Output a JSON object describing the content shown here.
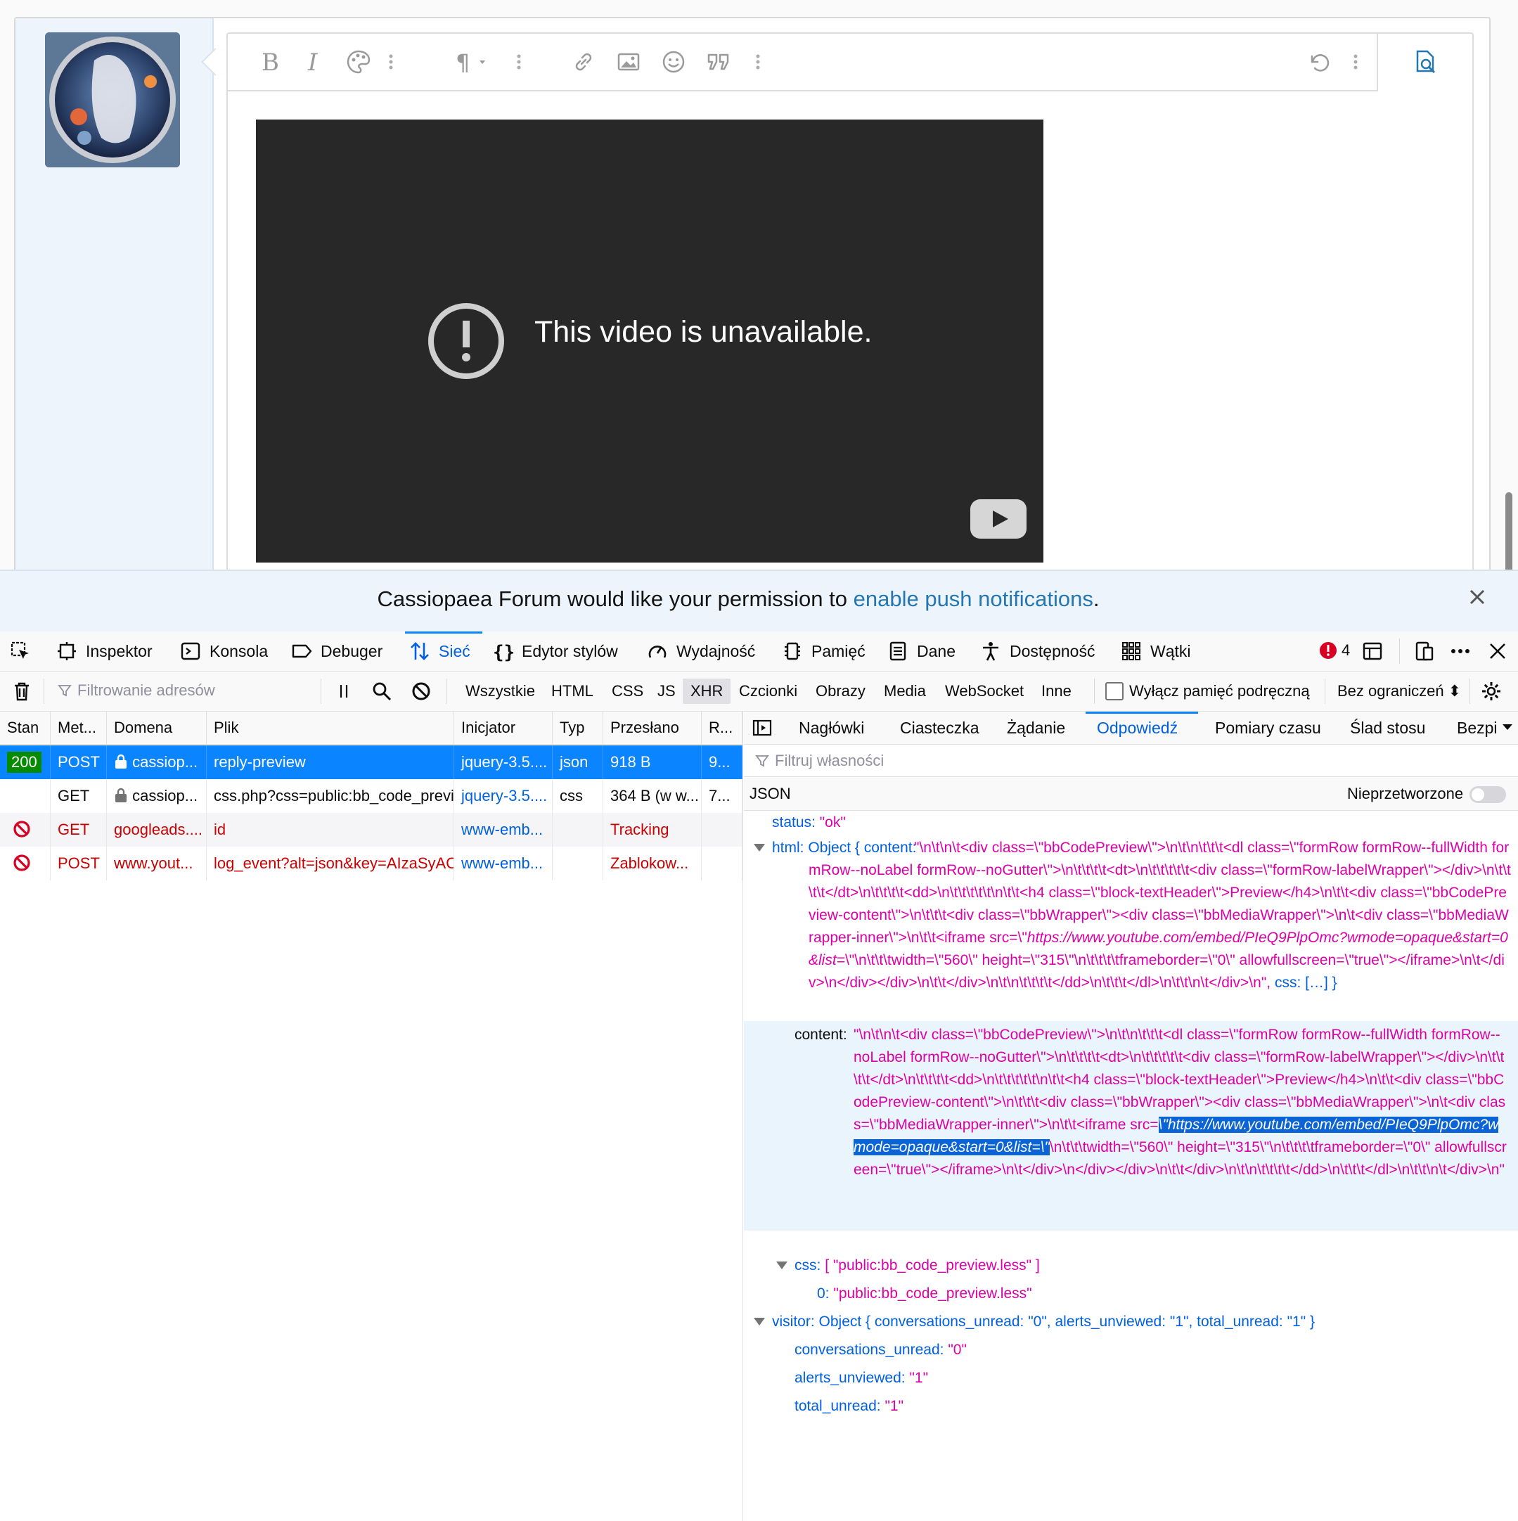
{
  "video": {
    "message": "This video is unavailable."
  },
  "notification": {
    "text_before": "Cassiopaea Forum would like your permission to ",
    "link": "enable push notifications",
    "text_after": "."
  },
  "devtools": {
    "tabs": [
      {
        "label": "Inspektor"
      },
      {
        "label": "Konsola"
      },
      {
        "label": "Debuger"
      },
      {
        "label": "Sieć"
      },
      {
        "label": "Edytor stylów"
      },
      {
        "label": "Wydajność"
      },
      {
        "label": "Pamięć"
      },
      {
        "label": "Dane"
      },
      {
        "label": "Dostępność"
      },
      {
        "label": "Wątki"
      }
    ],
    "error_count": "4",
    "filter_placeholder": "Filtrowanie adresów",
    "filter_types": [
      "Wszystkie",
      "HTML",
      "CSS",
      "JS",
      "XHR",
      "Czcionki",
      "Obrazy",
      "Media",
      "WebSocket",
      "Inne"
    ],
    "disable_cache_label": "Wyłącz pamięć podręczną",
    "throttle": "Bez ograniczeń",
    "columns": [
      "Stan",
      "Met...",
      "Domena",
      "Plik",
      "Inicjator",
      "Typ",
      "Przesłano",
      "R..."
    ],
    "requests": [
      {
        "status": "200",
        "method": "POST",
        "domain": "cassiop...",
        "file": "reply-preview",
        "initiator": "jquery-3.5....",
        "type": "json",
        "transferred": "918 B",
        "size": "9..."
      },
      {
        "status": "",
        "method": "GET",
        "domain": "cassiop...",
        "file": "css.php?css=public:bb_code_previe",
        "initiator": "jquery-3.5....",
        "type": "css",
        "transferred": "364 B (w w...",
        "size": "7..."
      },
      {
        "status": "",
        "method": "GET",
        "domain": "googleads....",
        "file": "id",
        "initiator": "www-emb...",
        "type": "",
        "transferred": "Tracking",
        "size": ""
      },
      {
        "status": "",
        "method": "POST",
        "domain": "www.yout...",
        "file": "log_event?alt=json&key=AIzaSyAO",
        "initiator": "www-emb...",
        "type": "",
        "transferred": "Zablokow...",
        "size": ""
      }
    ],
    "detail_tabs": [
      "Nagłówki",
      "Ciasteczka",
      "Żądanie",
      "Odpowiedź",
      "Pomiary czasu",
      "Ślad stosu",
      "Bezpi"
    ],
    "prop_filter_placeholder": "Filtruj własności",
    "json_label": "JSON",
    "raw_label": "Nieprzetworzone",
    "json": {
      "status_key": "status:",
      "status_val": "\"ok\"",
      "html_key": "html:",
      "html_obj": "Object { content:",
      "html_text_1": "\"\\n\\t\\n\\t<div class=\\\"bbCodePreview\\\">\\n\\t\\n\\t\\t\\t<dl class=\\\"formRow formRow--fullWidth formRow--noLabel formRow--noGutter\\\">\\n\\t\\t\\t\\t<dt>\\n\\t\\t\\t\\t\\t<div class=\\\"formRow-labelWrapper\\\"></div>\\n\\t\\t\\t\\t</dt>\\n\\t\\t\\t\\t<dd>\\n\\t\\t\\t\\t\\t\\n\\t\\t<h4 class=\\\"block-textHeader\\\">Preview</h4>\\n\\t\\t<div class=\\\"bbCodePreview-content\\\">\\n\\t\\t\\t<div class=\\\"bbWrapper\\\"><div class=\\\"bbMediaWrapper\\\">\\n\\t<div class=\\\"bbMediaWrapper-inner\\\">\\n\\t\\t<iframe src=\\\"",
      "html_url": "https://www.youtube.com/embed/PIeQ9PlpOmc?wmode=opaque&start=0&list=",
      "html_text_2": "\\\"\\n\\t\\t\\twidth=\\\"560\\\" height=\\\"315\\\"\\n\\t\\t\\t\\tframeborder=\\\"0\\\" allowfullscreen=\\\"true\\\"></iframe>\\n\\t</div>\\n</div></div>\\n\\t\\t</div>\\n\\t\\n\\t\\t\\t\\t</dd>\\n\\t\\t\\t</dl>\\n\\t\\t\\n\\t</div>\\n\",",
      "html_css": "css: […] }",
      "content_key": "content:",
      "content_text_1": "\"\\n\\t\\n\\t<div class=\\\"bbCodePreview\\\">\\n\\t\\n\\t\\t\\t<dl class=\\\"formRow formRow--fullWidth formRow--noLabel formRow--noGutter\\\">\\n\\t\\t\\t\\t<dt>\\n\\t\\t\\t\\t\\t<div class=\\\"formRow-labelWrapper\\\"></div>\\n\\t\\t\\t\\t</dt>\\n\\t\\t\\t\\t<dd>\\n\\t\\t\\t\\t\\t\\n\\t\\t<h4 class=\\\"block-textHeader\\\">Preview</h4>\\n\\t\\t<div class=\\\"bbCodePreview-content\\\">\\n\\t\\t\\t<div class=\\\"bbWrapper\\\"><div class=\\\"bbMediaWrapper\\\">\\n\\t<div class=\\\"bbMediaWrapper-inner\\\">\\n\\t\\t<iframe src=",
      "content_selected": "\\\"https://www.youtube.com/embed/PIeQ9PlpOmc?wmode=opaque&start=0&list=\\\"",
      "content_text_2": "\\n\\t\\t\\twidth=\\\"560\\\" height=\\\"315\\\"\\n\\t\\t\\t\\tframeborder=\\\"0\\\" allowfullscreen=\\\"true\\\"></iframe>\\n\\t</div>\\n</div></div>\\n\\t\\t</div>\\n\\t\\n\\t\\t\\t\\t</dd>\\n\\t\\t\\t</dl>\\n\\t\\t\\n\\t</div>\\n\"",
      "css_key": "css:",
      "css_val": "[ \"public:bb_code_preview.less\" ]",
      "css0_key": "0:",
      "css0_val": "\"public:bb_code_preview.less\"",
      "visitor_key": "visitor:",
      "visitor_obj": "Object { conversations_unread: \"0\", alerts_unviewed: \"1\", total_unread: \"1\" }",
      "conv_key": "conversations_unread:",
      "conv_val": "\"0\"",
      "alerts_key": "alerts_unviewed:",
      "alerts_val": "\"1\"",
      "total_key": "total_unread:",
      "total_val": "\"1\""
    }
  },
  "colors": {
    "accent": "#0a84ff",
    "tab_selected": "#0060df",
    "json_string": "#dd00a9",
    "json_key": "#0060df",
    "status_ok": "#058b00",
    "blocked": "#cc0000"
  }
}
